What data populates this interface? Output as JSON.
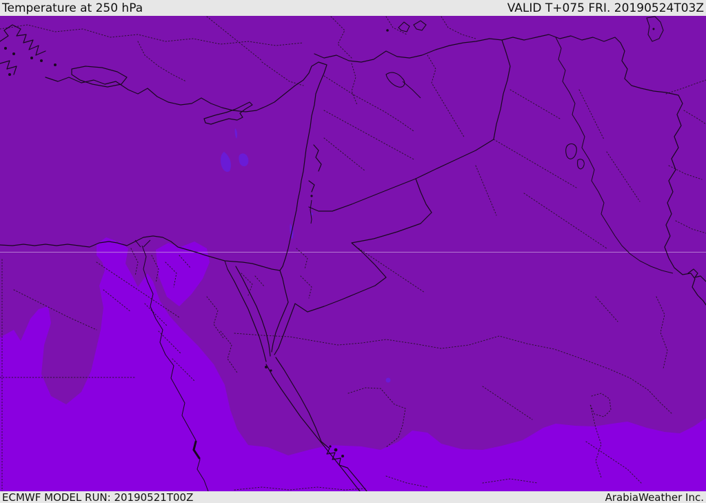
{
  "header": {
    "title": "Temperature at 250 hPa",
    "valid_label": "VALID T+075 FRI. 20190524T03Z"
  },
  "footer": {
    "model_run": "ECMWF MODEL RUN: 20190521T00Z",
    "brand": "ArabiaWeather Inc."
  },
  "map": {
    "description": "Filled temperature contour map over the Middle East with country and province borders",
    "colors": {
      "base_purple": "#7C12AE",
      "bright_purple": "#8A00E0",
      "cold_blob_purple": "#6A1BD6",
      "border_line": "#1a0720",
      "admin_dotted": "#2d1133",
      "gridline": "#CDA3E0",
      "bar_background": "#E7E7E7",
      "bar_text": "#111111"
    }
  }
}
